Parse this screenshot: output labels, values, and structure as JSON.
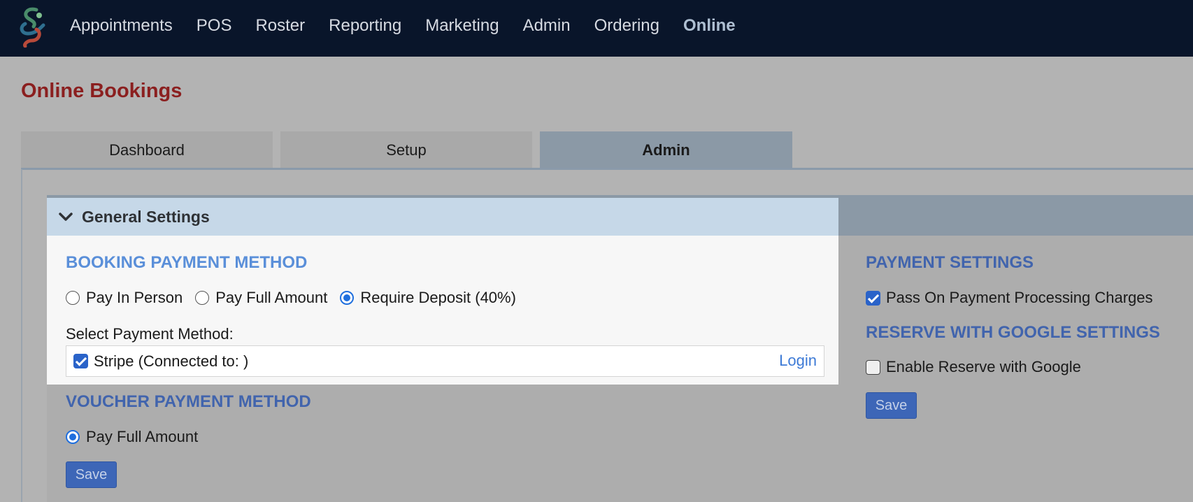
{
  "nav": {
    "logo": "app-logo",
    "items": [
      {
        "label": "Appointments"
      },
      {
        "label": "POS"
      },
      {
        "label": "Roster"
      },
      {
        "label": "Reporting"
      },
      {
        "label": "Marketing"
      },
      {
        "label": "Admin"
      },
      {
        "label": "Ordering"
      },
      {
        "label": "Online",
        "active": true
      }
    ]
  },
  "page": {
    "title": "Online Bookings"
  },
  "tabs": [
    {
      "label": "Dashboard"
    },
    {
      "label": "Setup"
    },
    {
      "label": "Admin",
      "active": true
    }
  ],
  "general_settings": {
    "header": "General Settings",
    "booking_payment": {
      "heading": "BOOKING PAYMENT METHOD",
      "options": [
        {
          "label": "Pay In Person",
          "checked": false
        },
        {
          "label": "Pay Full Amount",
          "checked": false
        },
        {
          "label": "Require Deposit (40%)",
          "checked": true
        }
      ],
      "select_label": "Select Payment Method:",
      "method": {
        "label": "Stripe (Connected to: )",
        "checked": true,
        "link": "Login"
      }
    },
    "voucher_payment": {
      "heading": "VOUCHER PAYMENT METHOD",
      "option": {
        "label": "Pay Full Amount",
        "checked": true
      },
      "save": "Save"
    },
    "payment_settings": {
      "heading": "PAYMENT SETTINGS",
      "pass_on": {
        "label": "Pass On Payment Processing Charges",
        "checked": true
      }
    },
    "google": {
      "heading": "RESERVE WITH GOOGLE SETTINGS",
      "enable": {
        "label": "Enable Reserve with Google",
        "checked": false
      },
      "save": "Save"
    }
  },
  "colors": {
    "nav_bg": "#09152a",
    "title": "#8b1f1f",
    "heading_blue": "#5a8fd9",
    "button_blue": "#3d66b7",
    "active_tab": "#8b99a6",
    "header_active": "#c6d8e8"
  }
}
